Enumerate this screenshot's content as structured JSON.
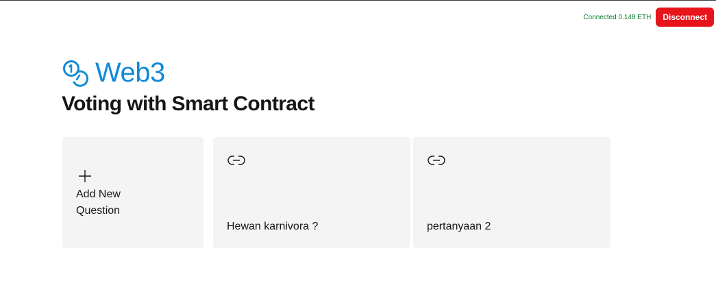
{
  "header": {
    "status_text": "Connected 0.148 ETH",
    "disconnect_label": "Disconnect"
  },
  "brand": {
    "name": "Web3",
    "logo_icon": "linked-coins-icon"
  },
  "page": {
    "title": "Voting with Smart Contract"
  },
  "tiles": {
    "add": {
      "icon": "plus-icon",
      "label": "Add New Question"
    },
    "questions": [
      {
        "icon": "link-icon",
        "label": "Hewan karnivora ?"
      },
      {
        "icon": "link-icon",
        "label": "pertanyaan 2"
      }
    ]
  },
  "colors": {
    "accent": "#0f8ad8",
    "status": "#0a7a2f",
    "danger": "#e8141c",
    "tile_bg": "#f4f4f4"
  }
}
